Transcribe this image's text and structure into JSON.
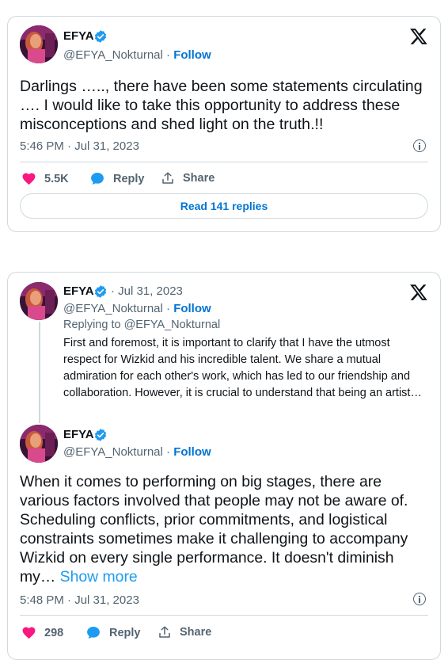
{
  "tweet1": {
    "name": "EFYA",
    "handle": "@EFYA_Nokturnal",
    "sep": " · ",
    "follow": "Follow",
    "text": "Darlings ….., there have been some statements circulating …. I would like to take this opportunity to address these misconceptions and shed light on the truth.!!",
    "timestamp": "5:46 PM · Jul 31, 2023",
    "likes": "5.5K",
    "reply_label": "Reply",
    "share_label": "Share",
    "read_replies": "Read 141 replies"
  },
  "tweet2": {
    "quoted": {
      "name": "EFYA",
      "date": "· Jul 31, 2023",
      "handle": "@EFYA_Nokturnal",
      "sep": " · ",
      "follow": "Follow",
      "replying_to": "Replying to @EFYA_Nokturnal",
      "text": "First and foremost, it is important to clarify that I have the utmost respect for Wizkid and his incredible talent. We share a mutual admiration for each other's work, which has led to our friendship and collaboration. However, it is crucial to understand that being an artist…"
    },
    "main": {
      "name": "EFYA",
      "handle": "@EFYA_Nokturnal",
      "sep": " · ",
      "follow": "Follow",
      "text": "When it comes to performing on big stages, there are various factors involved that people may not be aware of. Scheduling conflicts, prior commitments, and logistical constraints sometimes make it challenging to accompany Wizkid on every single performance. It doesn't diminish my…",
      "show_more": "Show more",
      "timestamp": "5:48 PM · Jul 31, 2023",
      "likes": "298",
      "reply_label": "Reply",
      "share_label": "Share"
    }
  },
  "colors": {
    "like": "#f91880",
    "reply": "#1d9bf0",
    "follow": "#0074d4",
    "verified": "#1d9bf0",
    "border": "#cfd9de",
    "muted": "#536471"
  },
  "icons": [
    "x-logo-icon",
    "verified-badge-icon",
    "heart-icon",
    "reply-bubble-icon",
    "share-icon",
    "info-icon"
  ]
}
